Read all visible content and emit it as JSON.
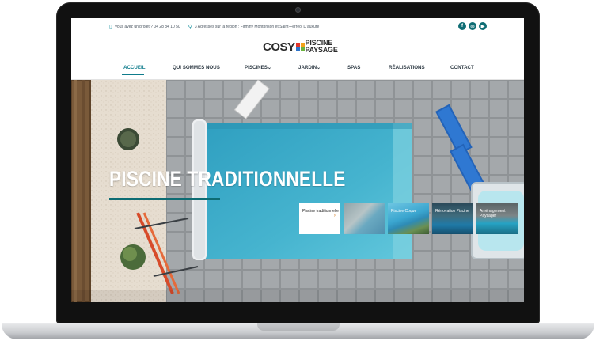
{
  "topbar": {
    "phone_text": "Vous avez un projet ? 04 28 84 10 50",
    "address_text": "3 Adresses sur la région : Firminy Montbrison et Saint-Ferréol D'auxure",
    "phone_icon": "phone-icon",
    "pin_icon": "map-pin-icon"
  },
  "socials": [
    {
      "name": "facebook-icon",
      "glyph": "f"
    },
    {
      "name": "instagram-icon",
      "glyph": "◎"
    },
    {
      "name": "youtube-icon",
      "glyph": "▶"
    }
  ],
  "logo": {
    "brand": "COSY",
    "line1": "PISCINE",
    "line2": "PAYSAGE",
    "colors": [
      "#e2362b",
      "#f3a21b",
      "#2f74c9",
      "#6cb33f"
    ]
  },
  "nav": {
    "items": [
      {
        "label": "ACCUEIL"
      },
      {
        "label": "QUI SOMMES NOUS"
      },
      {
        "label": "PISCINES⌄"
      },
      {
        "label": "JARDIN⌄"
      },
      {
        "label": "SPAS"
      },
      {
        "label": "RÉALISATIONS"
      },
      {
        "label": "CONTACT"
      }
    ],
    "active_color": "#0f7c8c"
  },
  "hero": {
    "title": "PISCINE TRADITIONNELLE",
    "accent_color": "#0d6c73"
  },
  "thumbnails": [
    {
      "label": "Piscine traditionnelle",
      "arrow": "›"
    },
    {
      "label": ""
    },
    {
      "label": "Piscine Coque"
    },
    {
      "label": "Rénovation Piscine"
    },
    {
      "label": "Aménagement Paysager"
    }
  ]
}
